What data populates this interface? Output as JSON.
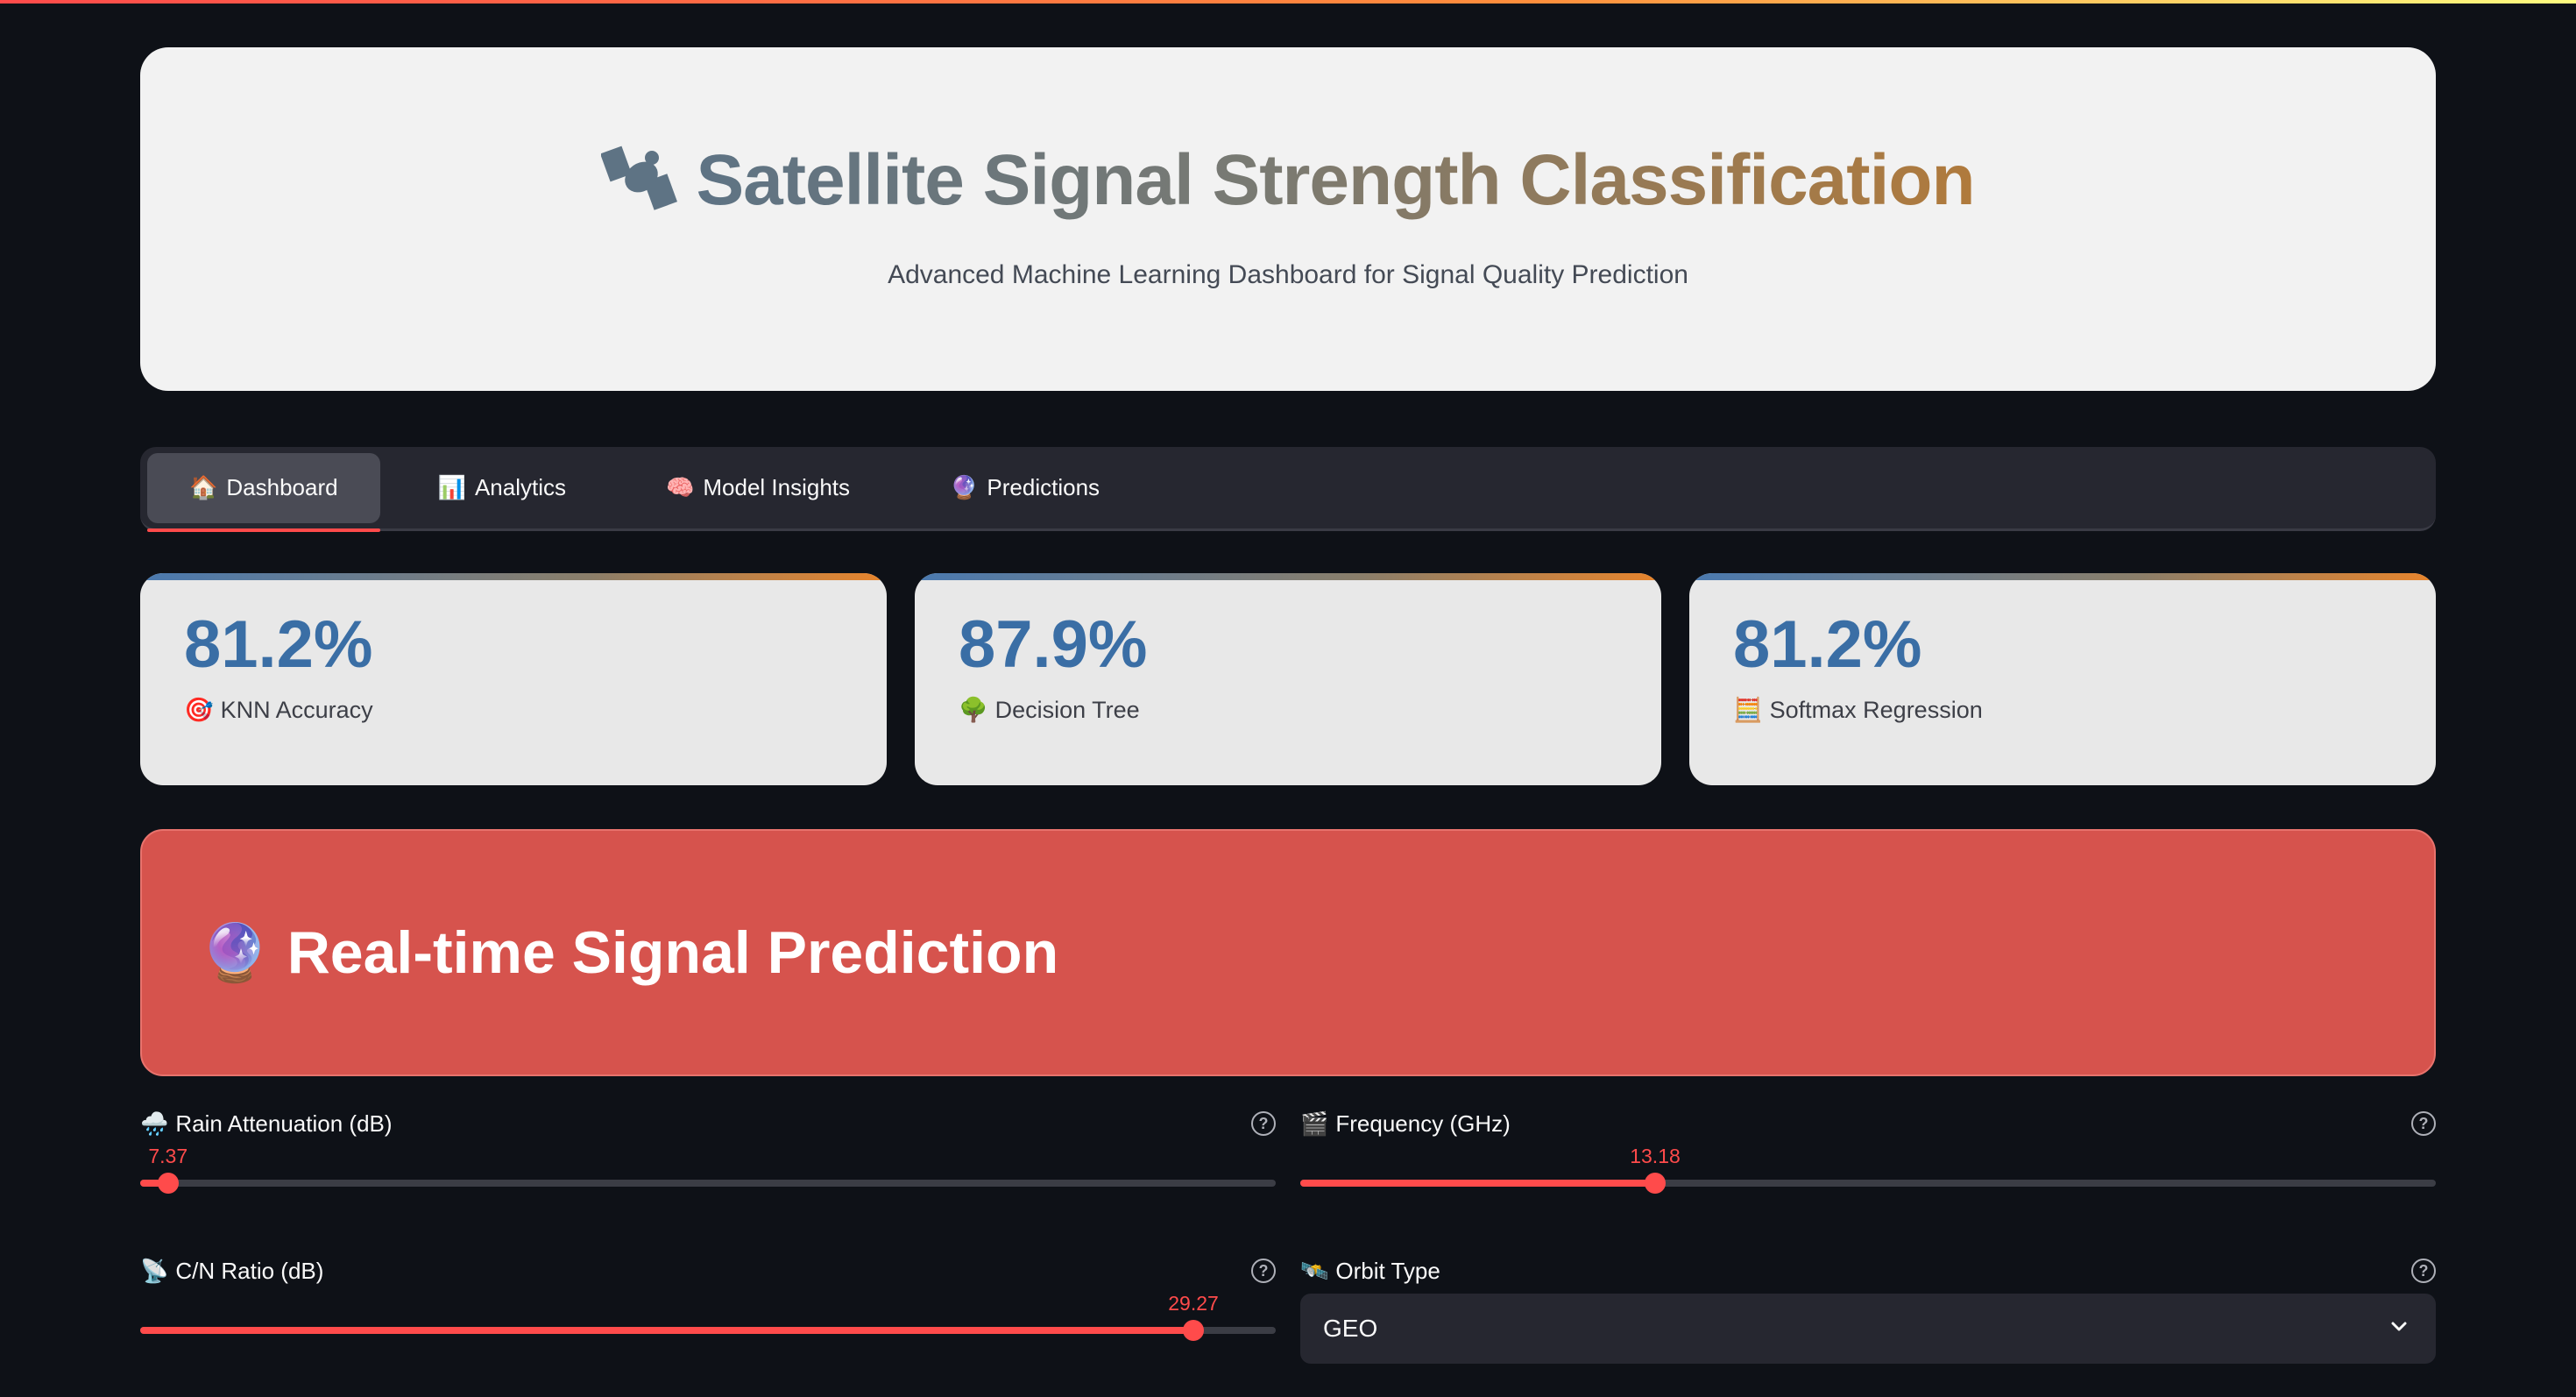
{
  "header": {
    "icon": "satellite-icon",
    "title": "Satellite Signal Strength Classification",
    "subtitle": "Advanced Machine Learning Dashboard for Signal Quality Prediction"
  },
  "tabs": [
    {
      "icon": "🏠",
      "label": "Dashboard",
      "active": true
    },
    {
      "icon": "📊",
      "label": "Analytics",
      "active": false
    },
    {
      "icon": "🧠",
      "label": "Model Insights",
      "active": false
    },
    {
      "icon": "🔮",
      "label": "Predictions",
      "active": false
    }
  ],
  "metrics": [
    {
      "value": "81.2%",
      "icon": "🎯",
      "label": "KNN Accuracy"
    },
    {
      "value": "87.9%",
      "icon": "🌳",
      "label": "Decision Tree"
    },
    {
      "value": "81.2%",
      "icon": "🧮",
      "label": "Softmax Regression"
    }
  ],
  "banner": {
    "icon": "🔮",
    "title": "Real-time Signal Prediction"
  },
  "controls": {
    "rain": {
      "icon": "🌧️",
      "label": "Rain Attenuation (dB)",
      "value": "7.37",
      "fraction": 0.0245
    },
    "frequency": {
      "icon": "🎬",
      "label": "Frequency (GHz)",
      "value": "13.18",
      "fraction": 0.3125
    },
    "cn": {
      "icon": "📡",
      "label": "C/N Ratio (dB)",
      "value": "29.27",
      "fraction": 0.9275
    },
    "orbit": {
      "icon": "🛰️",
      "label": "Orbit Type",
      "selected": "GEO"
    }
  },
  "colors": {
    "accent": "#ff4b4b",
    "metric_value": "#3a6ea5",
    "banner": "#d6534d"
  }
}
